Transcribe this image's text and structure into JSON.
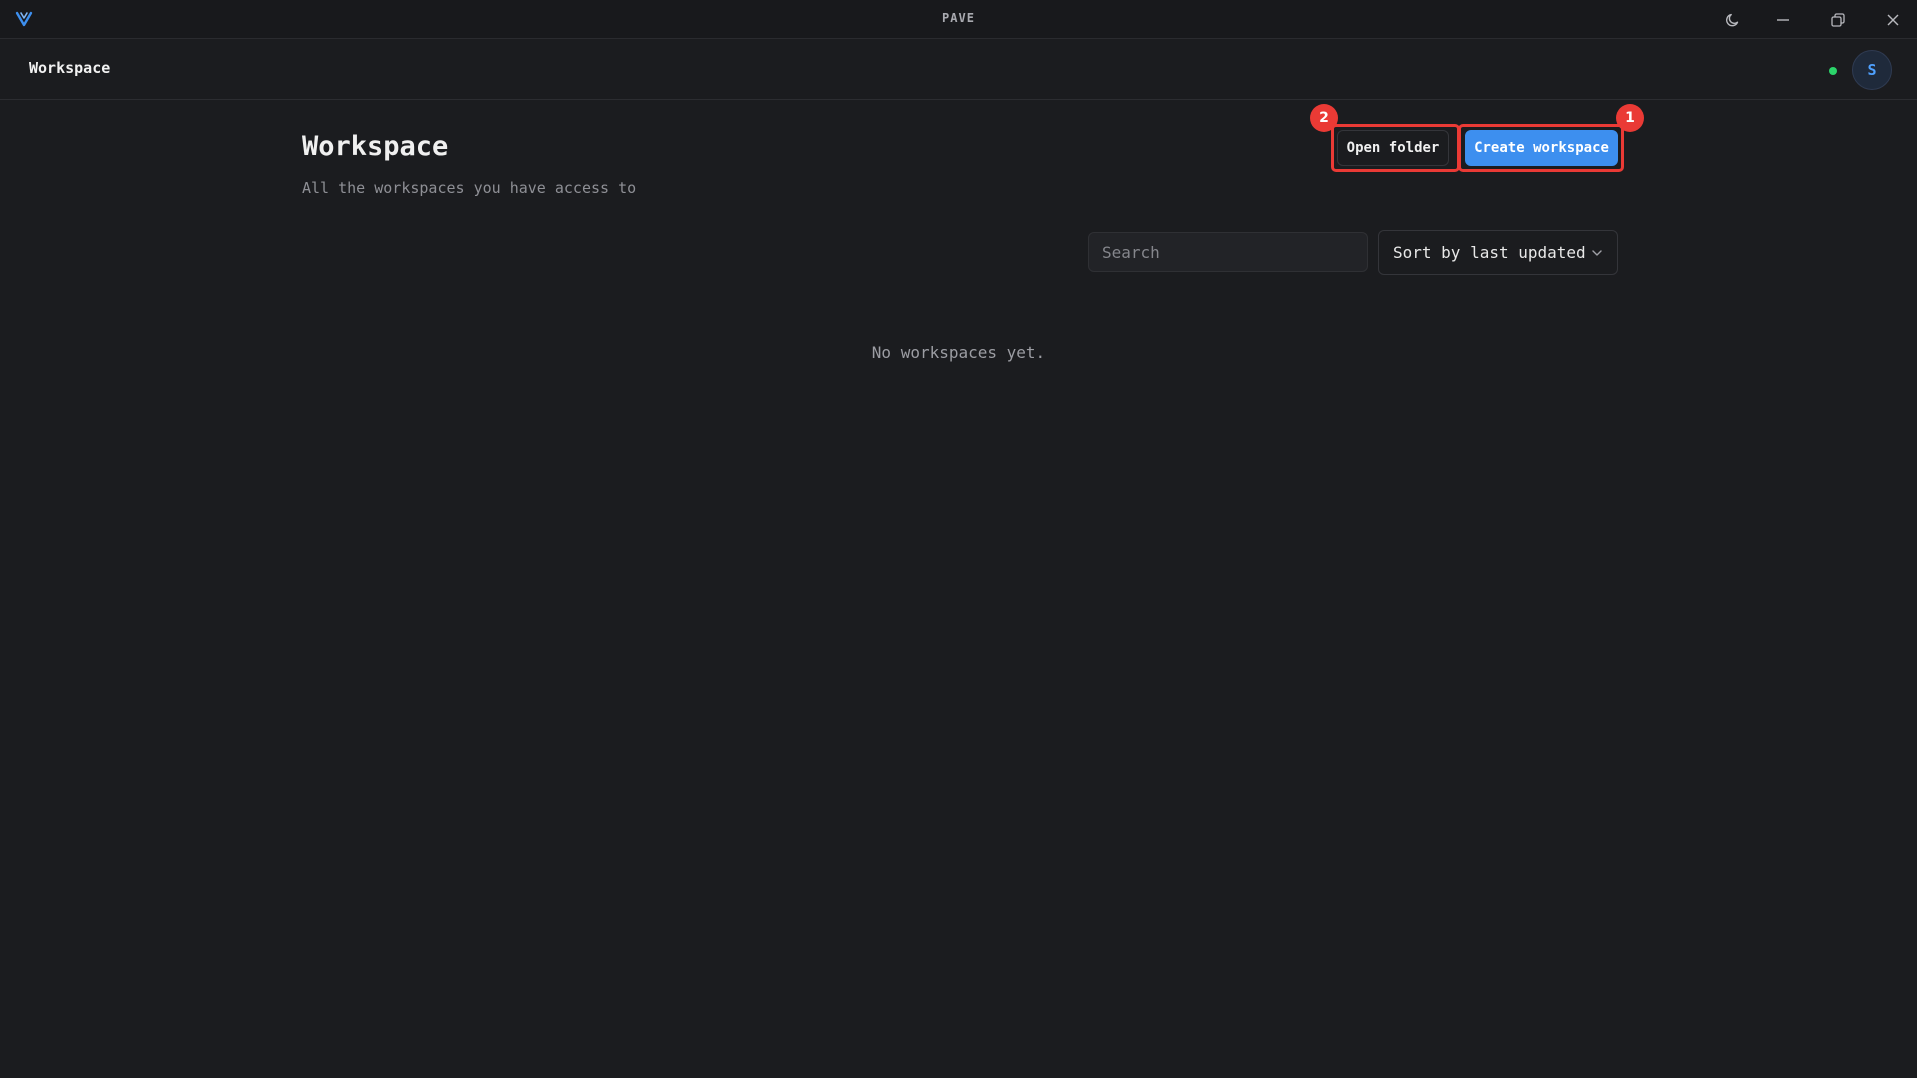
{
  "window": {
    "title": "PAVE",
    "controls": [
      "theme-toggle",
      "minimize",
      "restore",
      "close"
    ]
  },
  "header": {
    "title": "Workspace",
    "status": "online",
    "status_color": "#2bd46a",
    "avatar_initial": "S"
  },
  "main": {
    "title": "Workspace",
    "subtitle": "All the workspaces you have access to",
    "open_folder_label": "Open folder",
    "create_workspace_label": "Create workspace",
    "search": {
      "placeholder": "Search",
      "value": ""
    },
    "sort": {
      "selected": "Sort by last updated"
    },
    "empty_message": "No workspaces yet."
  },
  "annotations": [
    {
      "label": "2",
      "target": "open-folder-button"
    },
    {
      "label": "1",
      "target": "create-workspace-button"
    }
  ],
  "colors": {
    "accent": "#3d8fef",
    "annotation": "#ea3a35",
    "background": "#1b1c1f"
  }
}
